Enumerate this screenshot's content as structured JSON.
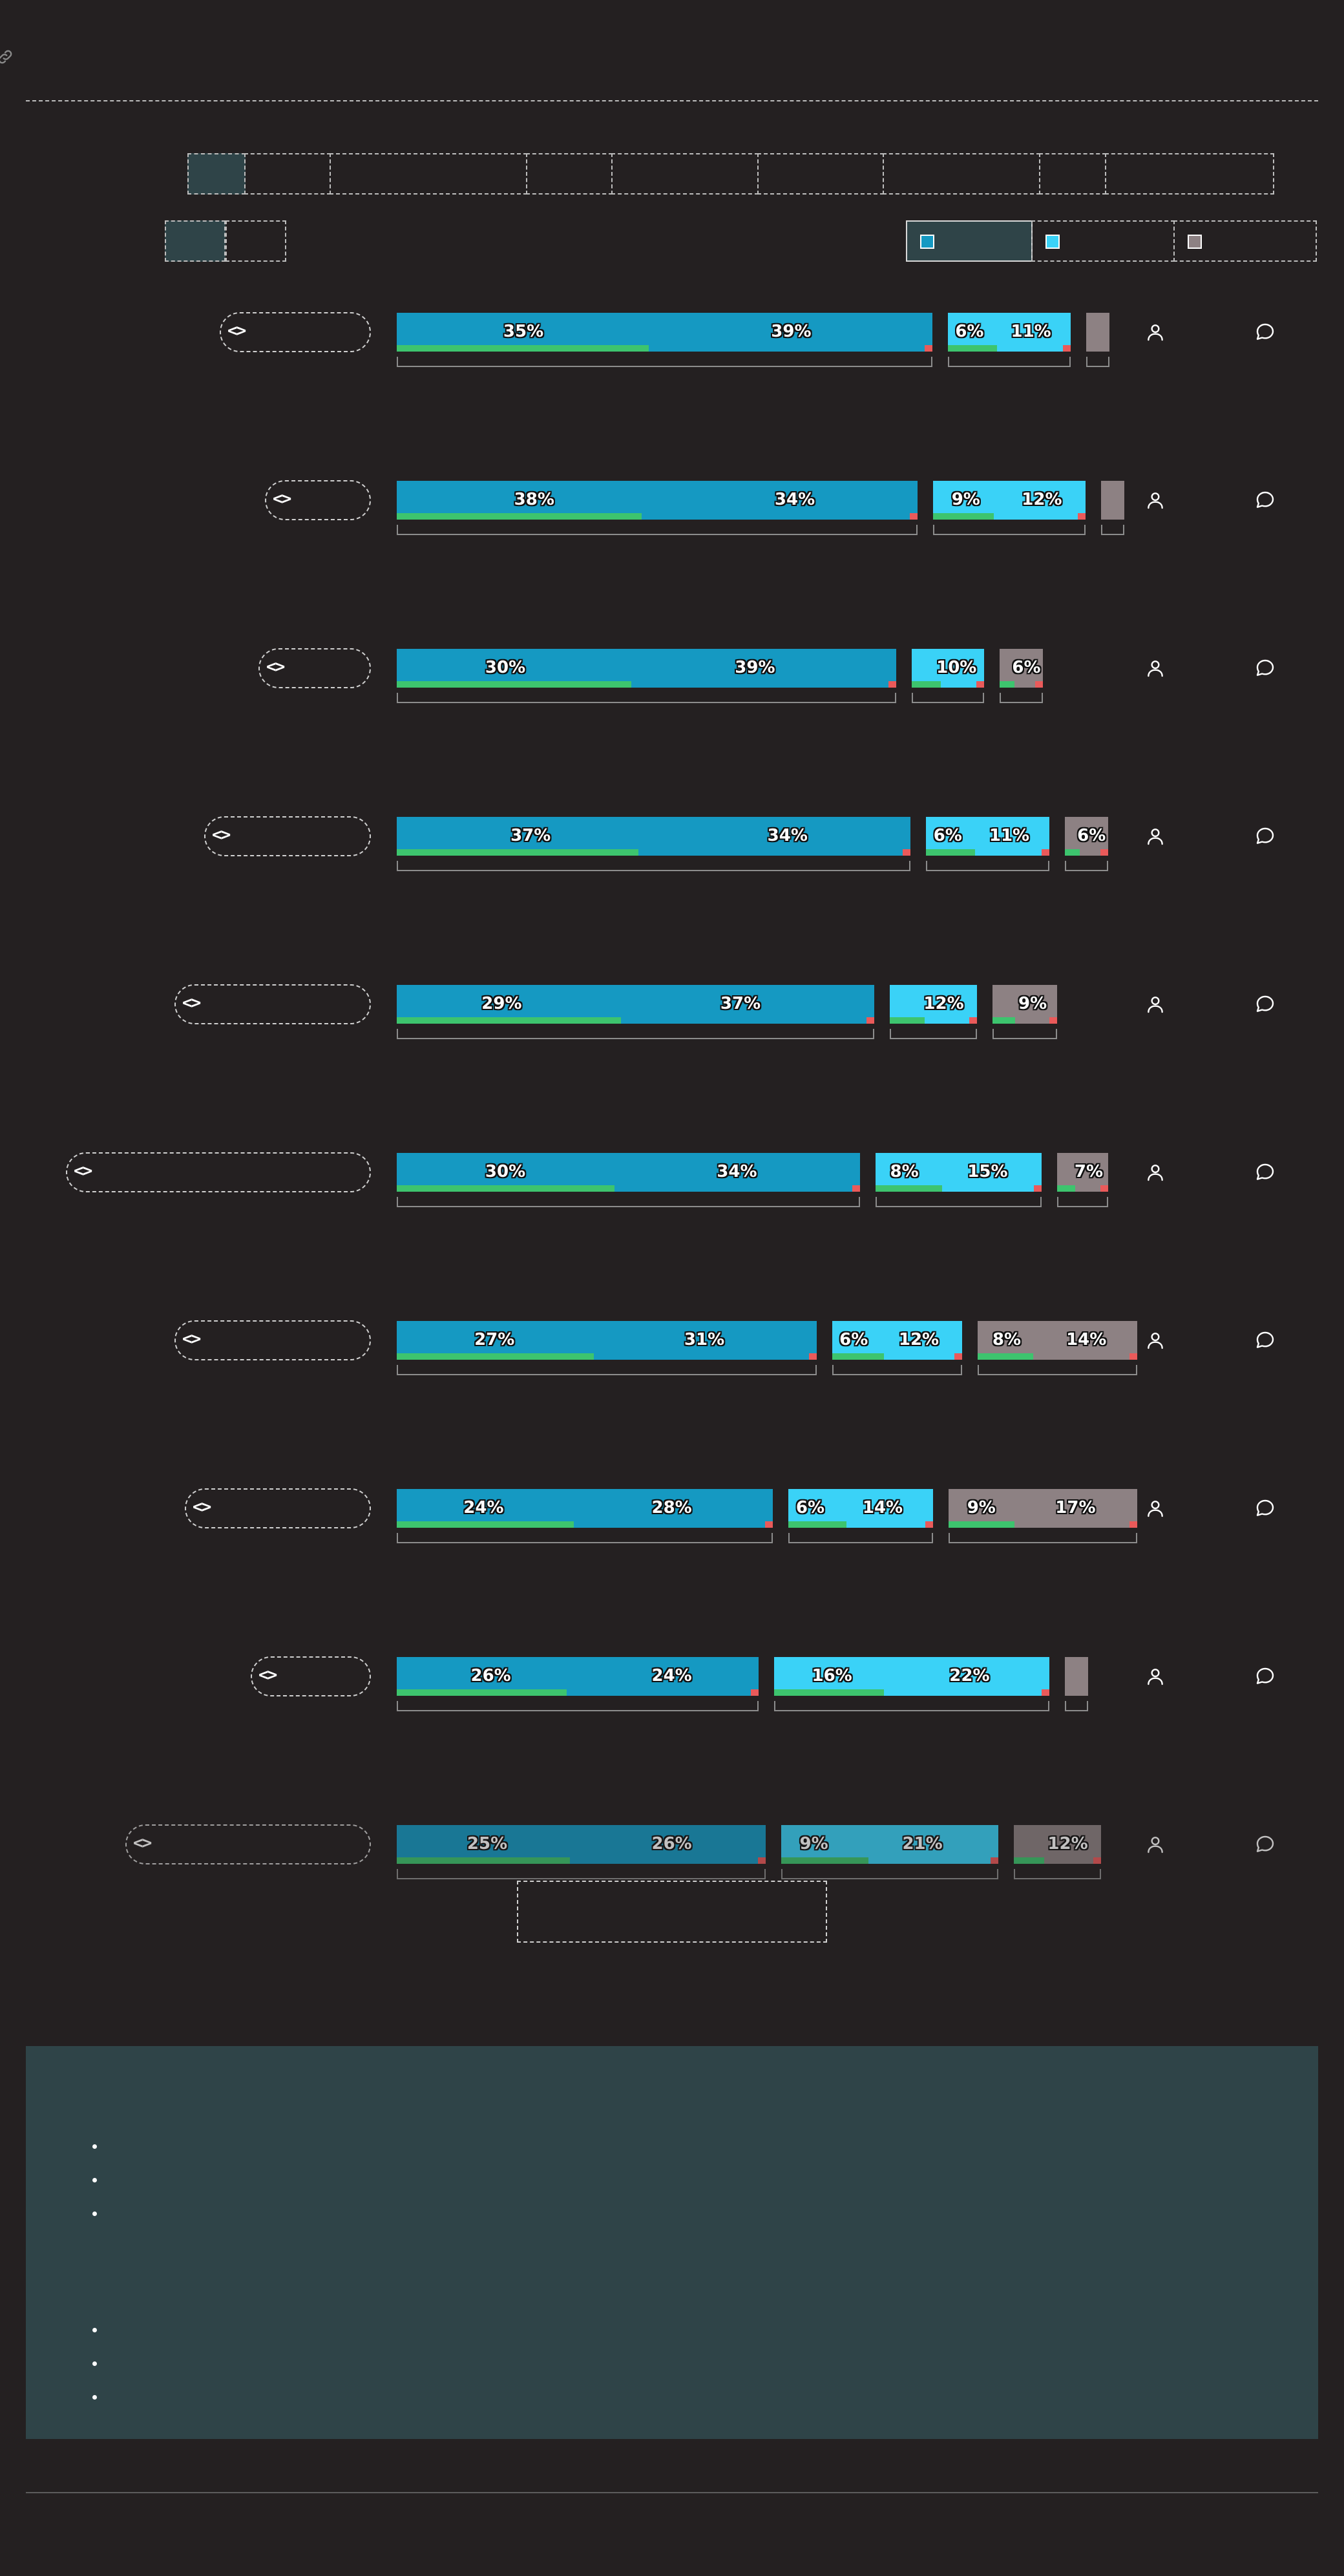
{
  "toolbar": {
    "segment_count": 9,
    "active_segment": 0,
    "view_toggle_count": 2,
    "active_toggle": 0
  },
  "legend": [
    {
      "name": "",
      "color": "#1599c2",
      "active": true
    },
    {
      "name": "",
      "color": "#3ad2f7",
      "active": false
    },
    {
      "name": "",
      "color": "#8d8183",
      "active": false
    }
  ],
  "row_icons": [
    "code-icon",
    "user-icon",
    "comment-icon"
  ],
  "chart_data": {
    "type": "bar",
    "orientation": "horizontal",
    "stacked": true,
    "groups": [
      "group-1",
      "group-2",
      "group-3"
    ],
    "colors": {
      "group-1": "#1599c2",
      "group-2": "#3ad2f7",
      "group-3": "#8d8183",
      "highlight": "#3dc46e",
      "marker": "#ea5a5a"
    },
    "rows": [
      {
        "segments": [
          [
            35,
            39
          ],
          [
            6,
            11
          ],
          [
            null
          ]
        ]
      },
      {
        "segments": [
          [
            38,
            34
          ],
          [
            9,
            12
          ],
          [
            null
          ]
        ]
      },
      {
        "segments": [
          [
            30,
            39
          ],
          [
            10
          ],
          [
            6
          ]
        ]
      },
      {
        "segments": [
          [
            37,
            34
          ],
          [
            6,
            11
          ],
          [
            6
          ]
        ]
      },
      {
        "segments": [
          [
            29,
            37
          ],
          [
            12
          ],
          [
            9
          ]
        ]
      },
      {
        "segments": [
          [
            30,
            34
          ],
          [
            8,
            15
          ],
          [
            7
          ]
        ]
      },
      {
        "segments": [
          [
            27,
            31
          ],
          [
            6,
            12
          ],
          [
            8,
            14
          ]
        ]
      },
      {
        "segments": [
          [
            24,
            28
          ],
          [
            6,
            14
          ],
          [
            9,
            17
          ]
        ]
      },
      {
        "segments": [
          [
            26,
            24
          ],
          [
            16,
            22
          ],
          [
            null
          ]
        ]
      },
      {
        "segments": [
          [
            25,
            26
          ],
          [
            9,
            21
          ],
          [
            12
          ]
        ]
      }
    ]
  },
  "notes": {
    "list_1_count": 3,
    "list_2_count": 3
  }
}
